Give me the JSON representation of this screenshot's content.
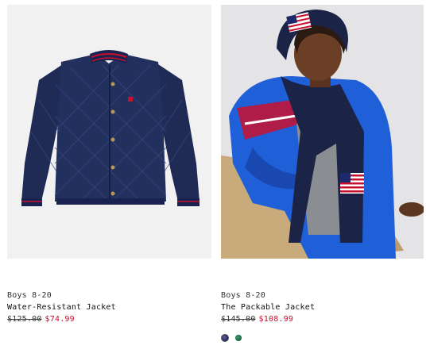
{
  "products": [
    {
      "category": "Boys 8-20",
      "name": "Water-Resistant Jacket",
      "original_price": "$125.00",
      "sale_price": "$74.99",
      "image_alt": "navy quilted jacket"
    },
    {
      "category": "Boys 8-20",
      "name": "The Packable Jacket",
      "original_price": "$145.00",
      "sale_price": "$108.99",
      "image_alt": "boy wearing blue packable jacket"
    }
  ],
  "swatches": [
    {
      "color": "#2a2f6e",
      "name": "navy"
    },
    {
      "color": "#2c7a52",
      "name": "green"
    }
  ],
  "colors": {
    "sale": "#c8102e",
    "text": "#1a1a1a"
  }
}
